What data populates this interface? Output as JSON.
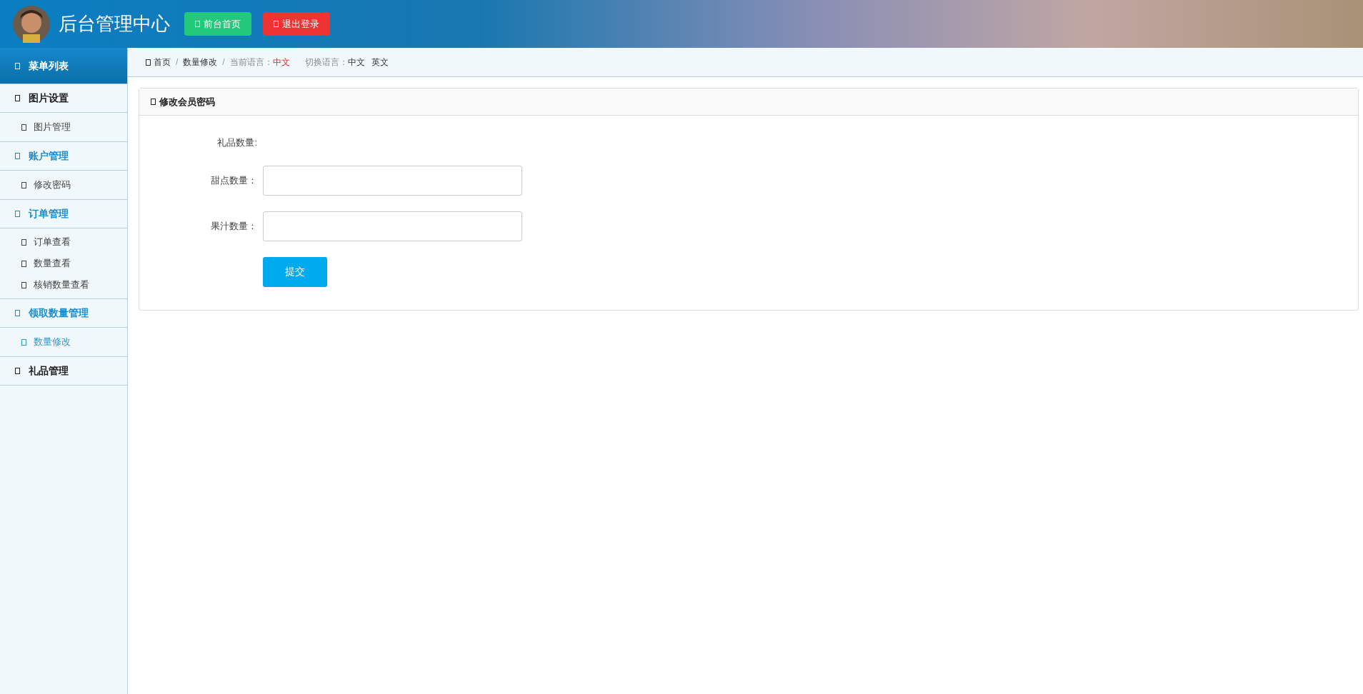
{
  "header": {
    "title": "后台管理中心",
    "buttons": [
      {
        "label": "前台首页",
        "kind": "home"
      },
      {
        "label": "退出登录",
        "kind": "logout"
      }
    ]
  },
  "sidebar": {
    "title": "菜单列表",
    "groups": [
      {
        "label": "图片设置",
        "active": false,
        "children": [
          {
            "label": "图片管理",
            "selected": false
          }
        ]
      },
      {
        "label": "账户管理",
        "active": true,
        "children": [
          {
            "label": "修改密码",
            "selected": false
          }
        ]
      },
      {
        "label": "订单管理",
        "active": true,
        "children": [
          {
            "label": "订单查看",
            "selected": false
          },
          {
            "label": "数量查看",
            "selected": false
          },
          {
            "label": "核销数量查看",
            "selected": false
          }
        ]
      },
      {
        "label": "领取数量管理",
        "active": true,
        "children": [
          {
            "label": "数量修改",
            "selected": true
          }
        ]
      },
      {
        "label": "礼品管理",
        "active": false
      }
    ]
  },
  "breadcrumb": {
    "separator": "/",
    "items": [
      "首页",
      "数量修改"
    ],
    "current_language_label": "当前语言：",
    "current_language": "中文",
    "switch_label": "切换语言：",
    "languages": [
      "中文",
      "英文"
    ]
  },
  "card": {
    "title": "修改会员密码",
    "fields": [
      {
        "kind": "static",
        "label": "礼品数量:"
      },
      {
        "kind": "input",
        "label": "甜点数量："
      },
      {
        "kind": "input",
        "label": "果汁数量："
      }
    ],
    "submit": "提交"
  }
}
